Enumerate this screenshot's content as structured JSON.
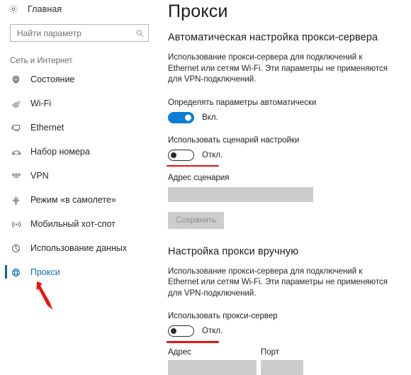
{
  "sidebar": {
    "home": {
      "label": "Главная",
      "icon": "gear-icon"
    },
    "search": {
      "placeholder": "Найти параметр",
      "value": "",
      "icon": "search-icon"
    },
    "group_label": "Сеть и Интернет",
    "items": [
      {
        "label": "Состояние",
        "icon": "globe-status-icon",
        "selected": false
      },
      {
        "label": "Wi-Fi",
        "icon": "wifi-icon",
        "selected": false
      },
      {
        "label": "Ethernet",
        "icon": "ethernet-icon",
        "selected": false
      },
      {
        "label": "Набор номера",
        "icon": "dialup-phone-icon",
        "selected": false
      },
      {
        "label": "VPN",
        "icon": "vpn-icon",
        "selected": false
      },
      {
        "label": "Режим «в самолете»",
        "icon": "airplane-icon",
        "selected": false
      },
      {
        "label": "Мобильный хот-спот",
        "icon": "hotspot-icon",
        "selected": false
      },
      {
        "label": "Использование данных",
        "icon": "pie-chart-icon",
        "selected": false
      },
      {
        "label": "Прокси",
        "icon": "globe-proxy-icon",
        "selected": true
      }
    ]
  },
  "main": {
    "title": "Прокси",
    "auto_section": {
      "heading": "Автоматическая настройка прокси-сервера",
      "description": "Использование прокси-сервера для подключений к Ethernet или сетям Wi-Fi. Эти параметры не применяются для VPN-подключений.",
      "auto_detect": {
        "label": "Определять параметры автоматически",
        "state": "Вкл.",
        "on": true
      },
      "use_script": {
        "label": "Использовать сценарий настройки",
        "state": "Откл.",
        "on": false
      },
      "script_address": {
        "label": "Адрес сценария",
        "value": "",
        "disabled": true
      },
      "save_label": "Сохранить"
    },
    "manual_section": {
      "heading": "Настройка прокси вручную",
      "description": "Использование прокси-сервера для подключений к Ethernet или сетям Wi-Fi. Эти параметры не применяются для VPN-подключений.",
      "use_proxy": {
        "label": "Использовать прокси-сервер",
        "state": "Откл.",
        "on": false
      },
      "address": {
        "label": "Адрес",
        "value": "",
        "disabled": true
      },
      "port": {
        "label": "Порт",
        "value": "",
        "disabled": true
      }
    }
  },
  "annotations": {
    "arrow_color": "#e8120e",
    "underline_color": "#e8120e"
  },
  "colors": {
    "accent": "#0c7cd5",
    "selected_text": "#0a6ebd",
    "selection_bar": "#1361a8",
    "disabled_field": "#cccccc",
    "disabled_button": "#cdcdcd"
  }
}
